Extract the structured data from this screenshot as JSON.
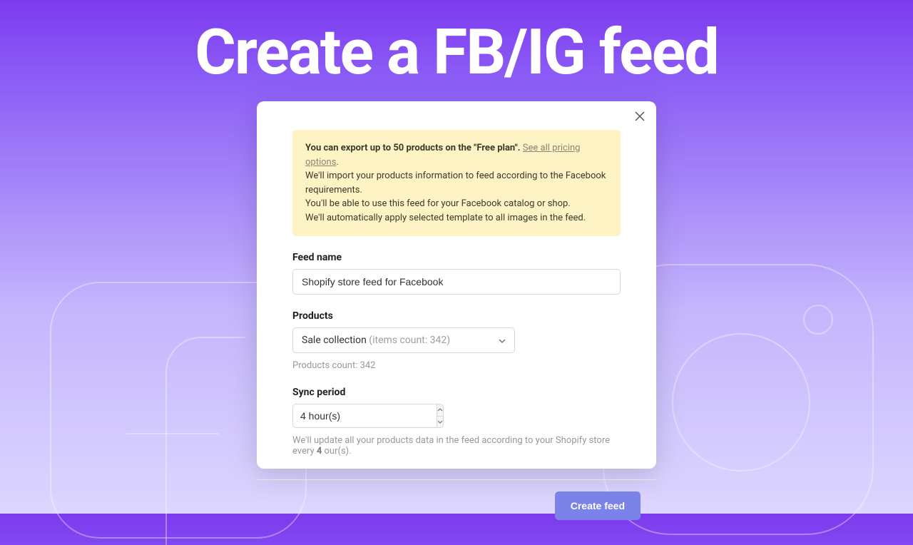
{
  "hero": {
    "title": "Create a FB/IG feed"
  },
  "banner": {
    "line1_strong": "You can export up to 50 products on the \"Free plan\".",
    "line1_link": "See all pricing options",
    "line1_period": ".",
    "line2": "We'll import your products information to feed according to the Facebook requirements.",
    "line3": "You'll be able to use this feed for your Facebook catalog or shop.",
    "line4": "We'll automatically apply selected template to all images in the feed."
  },
  "fields": {
    "feed_name_label": "Feed name",
    "feed_name_value": "Shopify store feed for Facebook",
    "products_label": "Products",
    "products_select_main": "Sale collection",
    "products_select_meta": "(items count: 342)",
    "products_count_text": "Products count: 342",
    "sync_label": "Sync period",
    "sync_value": "4 hour(s)",
    "sync_help_pre": "We'll update all your products data in the feed according to your Shopify store every ",
    "sync_help_bold": "4",
    "sync_help_post": " our(s)."
  },
  "footer": {
    "create_label": "Create feed"
  }
}
